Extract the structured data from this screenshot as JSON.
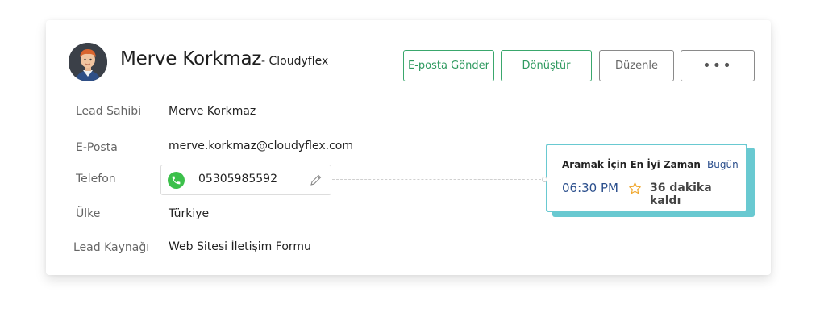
{
  "lead": {
    "name": "Merve Korkmaz",
    "company": "- Cloudyflex"
  },
  "actions": {
    "send_email": "E-posta Gönder",
    "convert": "Dönüştür",
    "edit": "Düzenle",
    "more": "•••"
  },
  "fields": {
    "owner_label": "Lead Sahibi",
    "owner_value": "Merve Korkmaz",
    "email_label": "E-Posta",
    "email_value": "merve.korkmaz@cloudyflex.com",
    "phone_label": "Telefon",
    "phone_value": "05305985592",
    "country_label": "Ülke",
    "country_value": "Türkiye",
    "source_label": "Lead Kaynağı",
    "source_value": "Web Sitesi İletişim Formu"
  },
  "best_time": {
    "title": "Aramak İçin En İyi Zaman",
    "day": "-Bugün",
    "time": "06:30 PM",
    "remaining": "36 dakika kaldı"
  },
  "colors": {
    "accent_green": "#3aa76d",
    "phone_green": "#3cc04b",
    "callout_teal": "#69c9d1",
    "time_blue": "#2a4e8c",
    "star": "#f0a62a"
  },
  "icons": {
    "phone": "phone-icon",
    "pencil": "pencil-icon",
    "star": "star-icon",
    "more": "more-icon"
  }
}
